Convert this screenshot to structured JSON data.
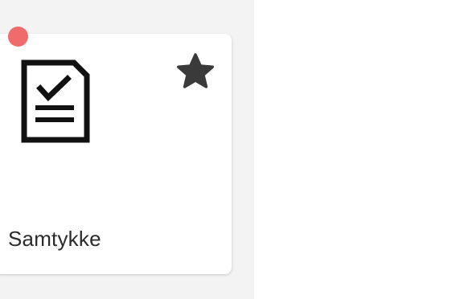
{
  "card": {
    "title": "Samtykke",
    "icon": "document-check-icon",
    "favorite_icon": "star-icon",
    "favorite": true
  },
  "status_dot": {
    "color": "#f06b6b"
  },
  "colors": {
    "panel_background": "#f3f3f3",
    "icon_color": "#111111",
    "star_color": "#3a3a3a"
  }
}
